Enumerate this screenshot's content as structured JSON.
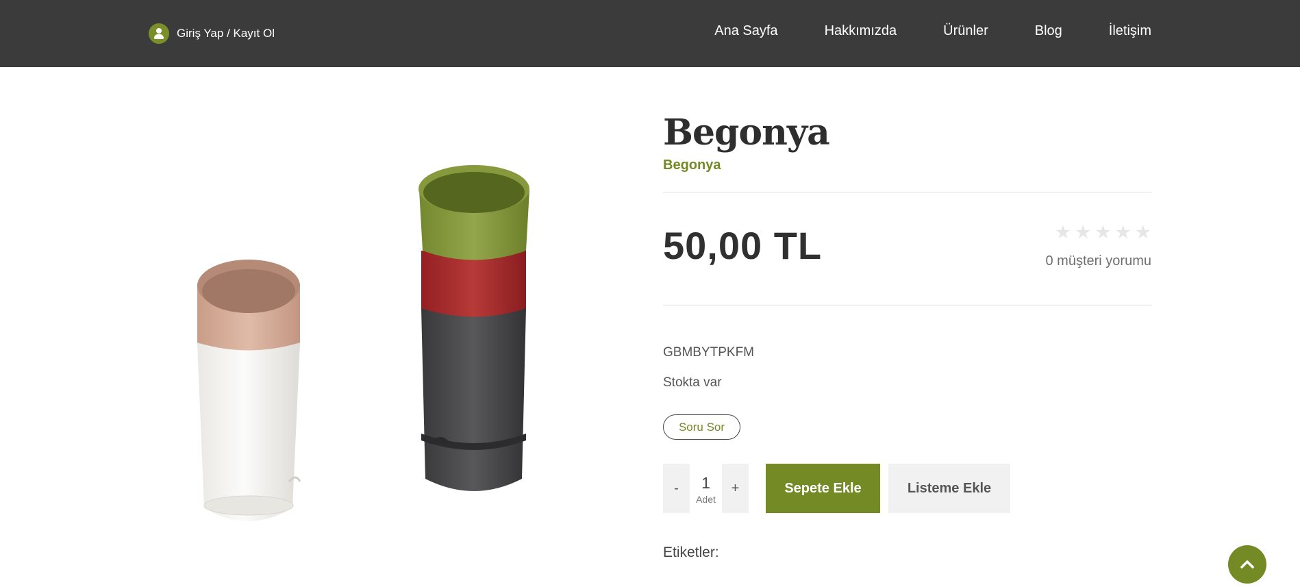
{
  "header": {
    "login_label": "Giriş Yap / Kayıt Ol",
    "nav": [
      "Ana Sayfa",
      "Hakkımızda",
      "Ürünler",
      "Blog",
      "İletişim"
    ]
  },
  "product": {
    "title": "Begonya",
    "subtitle": "Begonya",
    "price": "50,00 TL",
    "rating_stars": 0,
    "reviews": "0 müşteri yorumu",
    "sku": "GBMBYTPKFM",
    "stock": "Stokta var",
    "ask_button": "Soru Sor",
    "quantity": "1",
    "quantity_unit": "Adet",
    "minus": "-",
    "plus": "+",
    "add_to_cart": "Sepete Ekle",
    "add_to_list": "Listeme Ekle",
    "tags_label": "Etiketler:"
  },
  "colors": {
    "accent": "#748a24",
    "header_bg": "#3a3b3a",
    "pot_blush": "#d4ad99",
    "pot_white": "#f2f1ee",
    "pot_green": "#85993d",
    "pot_red": "#a82a2a",
    "pot_dark": "#444446"
  },
  "icons": {
    "login": "user-icon",
    "scroll_top": "chevron-up-icon",
    "rating": "star-icon"
  }
}
